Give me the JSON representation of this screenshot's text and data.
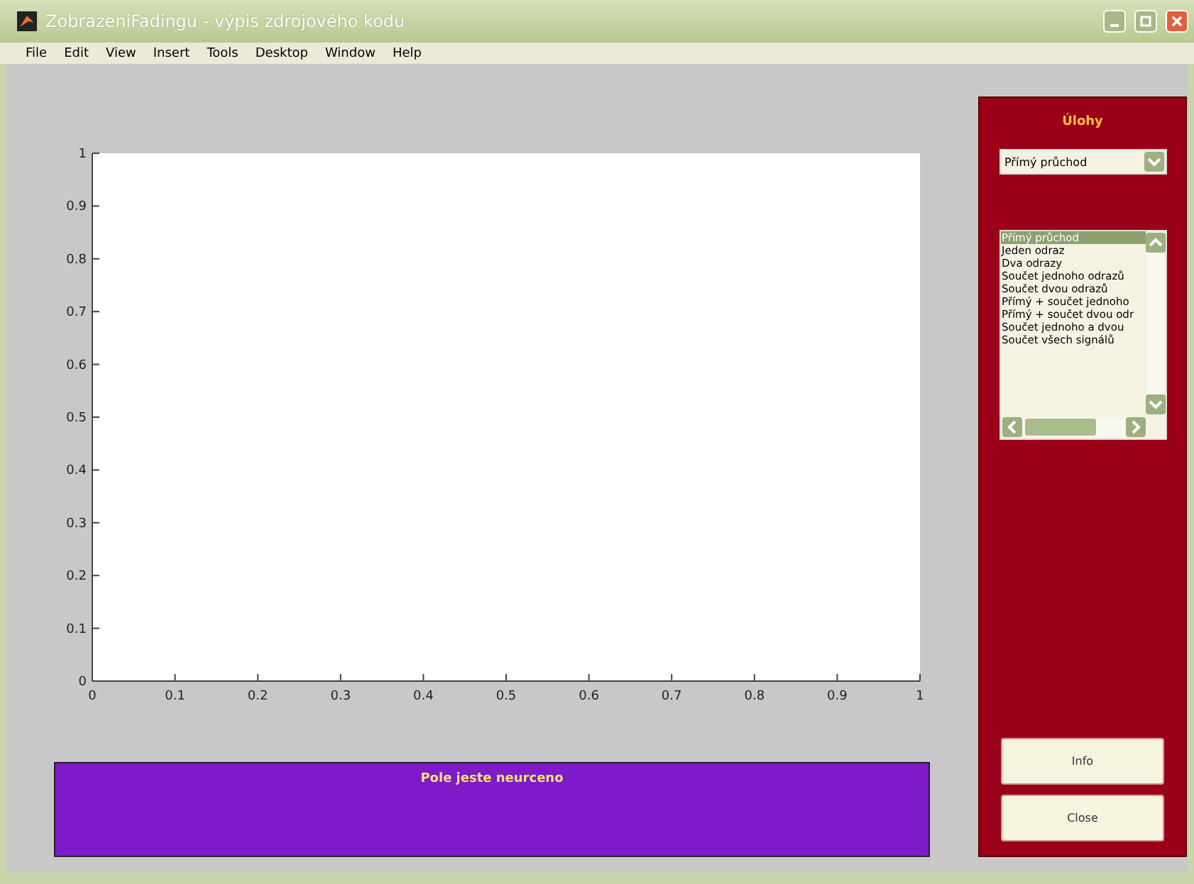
{
  "window": {
    "title": "ZobrazeniFadingu - výpis zdrojového kodu"
  },
  "menu": [
    "File",
    "Edit",
    "View",
    "Insert",
    "Tools",
    "Desktop",
    "Window",
    "Help"
  ],
  "axes": {
    "chart_data": {
      "type": "line",
      "xlim": [
        0,
        1
      ],
      "ylim": [
        0,
        1
      ],
      "xticks": [
        0,
        0.1,
        0.2,
        0.3,
        0.4,
        0.5,
        0.6,
        0.7,
        0.8,
        0.9,
        1
      ],
      "yticks": [
        0,
        0.1,
        0.2,
        0.3,
        0.4,
        0.5,
        0.6,
        0.7,
        0.8,
        0.9,
        1
      ]
    }
  },
  "status_panel": {
    "text": "Pole jeste neurceno"
  },
  "side_panel": {
    "title": "Úlohy",
    "dropdown": {
      "value": "Přímý průchod"
    },
    "list": [
      {
        "label": "Přímý průchod",
        "selected": true
      },
      {
        "label": "Jeden odraz",
        "selected": false
      },
      {
        "label": "Dva odrazy",
        "selected": false
      },
      {
        "label": "Součet jednoho odrazů",
        "selected": false
      },
      {
        "label": "Součet dvou odrazů",
        "selected": false
      },
      {
        "label": "Přímý + součet jednoho",
        "selected": false
      },
      {
        "label": "Přímý + součet dvou odr",
        "selected": false
      },
      {
        "label": "Součet jednoho a dvou",
        "selected": false
      },
      {
        "label": "Součet všech signálů",
        "selected": false
      }
    ],
    "buttons": [
      "Info",
      "Close"
    ]
  }
}
